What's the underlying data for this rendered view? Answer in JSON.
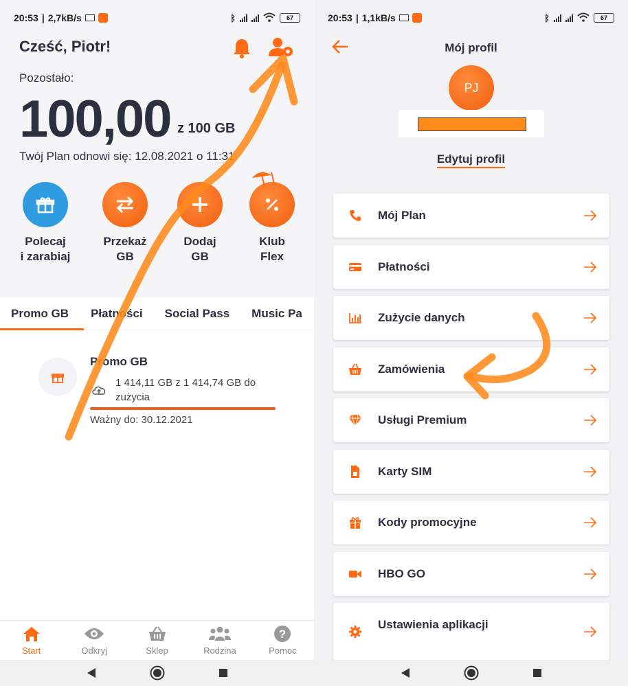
{
  "colors": {
    "accent": "#ff6a13",
    "blue": "#2f9be0",
    "text": "#2c2f3e"
  },
  "left": {
    "status": {
      "time": "20:53",
      "speed": "2,7kB/s",
      "battery": "67"
    },
    "greeting": "Cześć, Piotr!",
    "remaining_label": "Pozostało:",
    "remaining_value": "100,00",
    "remaining_total": "z 100 GB",
    "renew_text": "Twój Plan odnowi się: 12.08.2021 o 11:31",
    "actions": [
      {
        "line1": "Polecaj",
        "line2": "i zarabiaj",
        "icon": "gift-icon"
      },
      {
        "line1": "Przekaż",
        "line2": "GB",
        "icon": "transfer-icon"
      },
      {
        "line1": "Dodaj",
        "line2": "GB",
        "icon": "plus-icon"
      },
      {
        "line1": "Klub",
        "line2": "Flex",
        "icon": "percent-coconut-icon"
      }
    ],
    "tabs": [
      "Promo GB",
      "Płatności",
      "Social Pass",
      "Music Pa"
    ],
    "promo": {
      "title": "Promo GB",
      "usage": "1 414,11 GB z 1 414,74 GB do zużycia",
      "usage_fraction": 0.9996,
      "valid": "Ważny do: 30.12.2021"
    },
    "bottom_nav": [
      {
        "label": "Start",
        "icon": "home-icon"
      },
      {
        "label": "Odkryj",
        "icon": "eye-icon"
      },
      {
        "label": "Sklep",
        "icon": "basket-icon"
      },
      {
        "label": "Rodzina",
        "icon": "family-icon"
      },
      {
        "label": "Pomoc",
        "icon": "help-icon"
      }
    ]
  },
  "right": {
    "status": {
      "time": "20:53",
      "speed": "1,1kB/s",
      "battery": "67"
    },
    "title": "Mój profil",
    "avatar_initials": "PJ",
    "edit_profile": "Edytuj profil",
    "menu": [
      {
        "label": "Mój Plan",
        "icon": "phone-icon"
      },
      {
        "label": "Płatności",
        "icon": "card-icon"
      },
      {
        "label": "Zużycie danych",
        "icon": "chart-icon"
      },
      {
        "label": "Zamówienia",
        "icon": "basket-icon"
      },
      {
        "label": "Usługi Premium",
        "icon": "diamond-icon"
      },
      {
        "label": "Karty SIM",
        "icon": "sim-icon"
      },
      {
        "label": "Kody promocyjne",
        "icon": "gift-icon"
      },
      {
        "label": "HBO GO",
        "icon": "video-icon"
      },
      {
        "label": "Ustawienia aplikacji",
        "icon": "gear-icon"
      }
    ]
  }
}
